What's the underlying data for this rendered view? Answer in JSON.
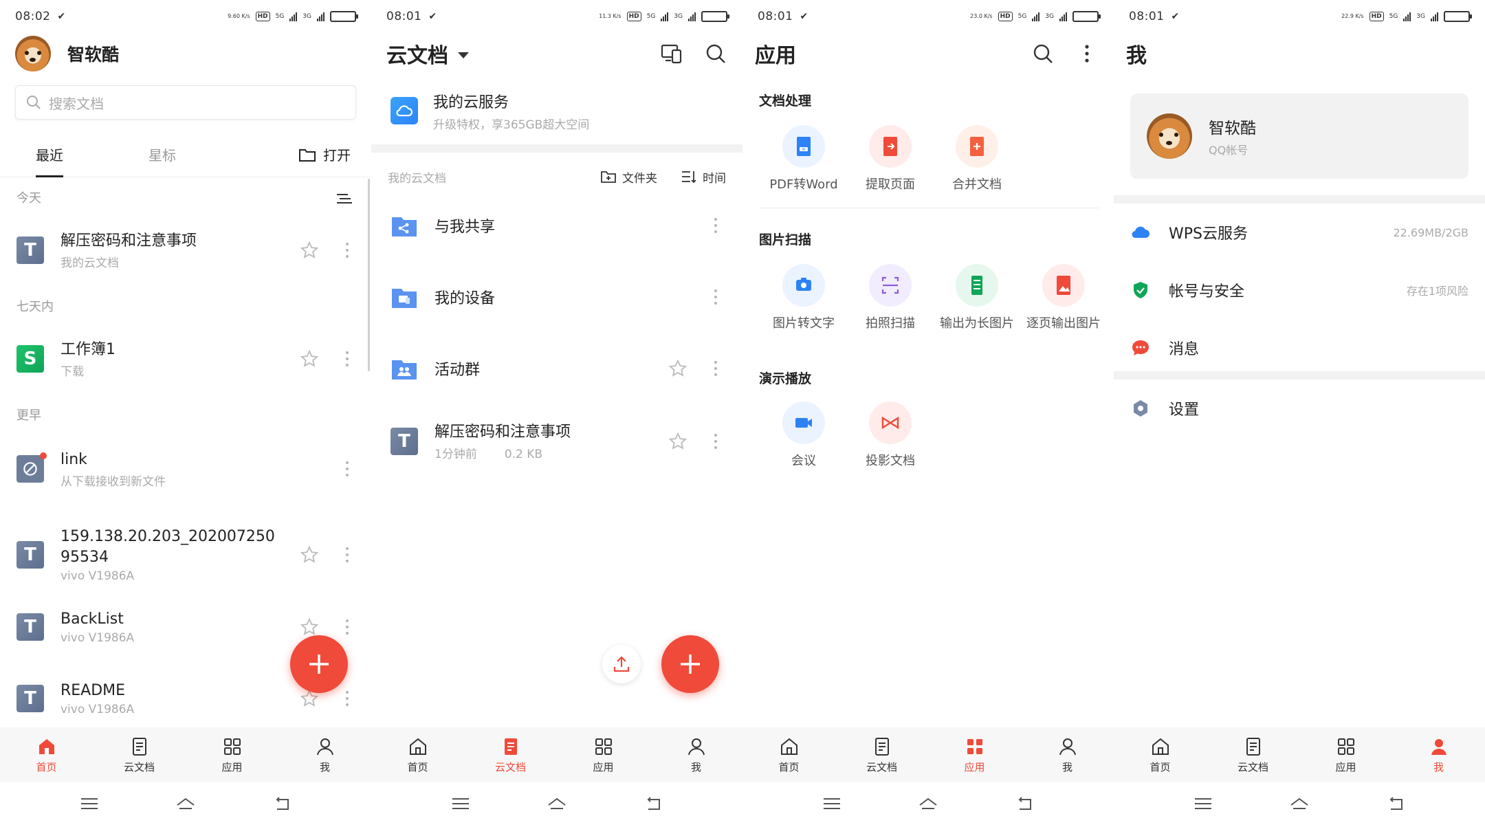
{
  "colors": {
    "accent": "#f04a3a",
    "text": "#222222",
    "muted": "#aaaaaa",
    "cloud_blue": "#2d83f5",
    "green": "#10a557"
  },
  "status_bars": [
    {
      "time": "08:02",
      "net": "9.60 K/s"
    },
    {
      "time": "08:01",
      "net": "11.3 K/s"
    },
    {
      "time": "08:01",
      "net": "23.0 K/s"
    },
    {
      "time": "08:01",
      "net": "22.9 K/s"
    }
  ],
  "status_common": {
    "hd": "HD",
    "sig1": "5G",
    "sig2": "3G"
  },
  "bottom_nav": [
    {
      "label": "首页",
      "icon": "home-icon"
    },
    {
      "label": "云文档",
      "icon": "document-icon"
    },
    {
      "label": "应用",
      "icon": "apps-grid-icon"
    },
    {
      "label": "我",
      "icon": "person-icon"
    }
  ],
  "home": {
    "user_name": "智软酷",
    "search_placeholder": "搜索文档",
    "tabs": [
      "最近",
      "星标"
    ],
    "open_label": "打开",
    "sections": {
      "today": "今天",
      "week": "七天内",
      "earlier": "更早"
    },
    "files": [
      {
        "title": "解压密码和注意事项",
        "sub": "我的云文档",
        "icon": "T"
      },
      {
        "title": "工作簿1",
        "sub": "下载",
        "icon": "S"
      },
      {
        "title": "link",
        "sub": "从下载接收到新文件",
        "icon": "link"
      },
      {
        "title": "159.138.20.203_202007250",
        "title2": "95534",
        "sub": "vivo V1986A",
        "icon": "T"
      },
      {
        "title": "BackList",
        "sub": "vivo V1986A",
        "icon": "T"
      },
      {
        "title": "README",
        "sub": "vivo V1986A",
        "icon": "T"
      }
    ]
  },
  "cloud": {
    "title": "云文档",
    "service_title": "我的云服务",
    "service_sub": "升级特权，享365GB超大空间",
    "section_label": "我的云文档",
    "folder_action": "文件夹",
    "sort_action": "时间",
    "items": [
      {
        "title": "与我共享",
        "icon": "share-folder-icon"
      },
      {
        "title": "我的设备",
        "icon": "device-folder-icon"
      },
      {
        "title": "活动群",
        "icon": "group-folder-icon"
      },
      {
        "title": "解压密码和注意事项",
        "sub_time": "1分钟前",
        "sub_size": "0.2 KB",
        "icon": "T"
      }
    ]
  },
  "apps": {
    "title": "应用",
    "groups": [
      {
        "title": "文档处理",
        "items": [
          {
            "label": "PDF转Word",
            "icon": "pdf-to-word-icon",
            "color": "#2d83f5",
            "bg": "#eaf3ff"
          },
          {
            "label": "提取页面",
            "icon": "extract-page-icon",
            "color": "#f04a3a",
            "bg": "#ffecea"
          },
          {
            "label": "合并文档",
            "icon": "merge-doc-icon",
            "color": "#f5603f",
            "bg": "#ffefe9"
          }
        ]
      },
      {
        "title": "图片扫描",
        "items": [
          {
            "label": "图片转文字",
            "icon": "image-to-text-icon",
            "color": "#2d83f5",
            "bg": "#eaf3ff"
          },
          {
            "label": "拍照扫描",
            "icon": "photo-scan-icon",
            "color": "#8a5cd6",
            "bg": "#f2ecff"
          },
          {
            "label": "输出为长图片",
            "icon": "long-image-icon",
            "color": "#10a557",
            "bg": "#e6f8ee"
          },
          {
            "label": "逐页输出图片",
            "icon": "page-image-icon",
            "color": "#f04a3a",
            "bg": "#ffecea"
          }
        ]
      },
      {
        "title": "演示播放",
        "items": [
          {
            "label": "会议",
            "icon": "meeting-icon",
            "color": "#2d83f5",
            "bg": "#eaf3ff"
          },
          {
            "label": "投影文档",
            "icon": "projection-icon",
            "color": "#f04a3a",
            "bg": "#ffecea"
          }
        ]
      }
    ]
  },
  "me": {
    "title": "我",
    "profile_name": "智软酷",
    "profile_sub": "QQ帐号",
    "rows": [
      {
        "label": "WPS云服务",
        "meta": "22.69MB/2GB",
        "icon": "cloud-icon"
      },
      {
        "label": "帐号与安全",
        "meta": "存在1项风险",
        "icon": "shield-icon"
      },
      {
        "label": "消息",
        "meta": "",
        "icon": "message-icon"
      },
      {
        "label": "设置",
        "meta": "",
        "icon": "settings-icon"
      }
    ]
  }
}
